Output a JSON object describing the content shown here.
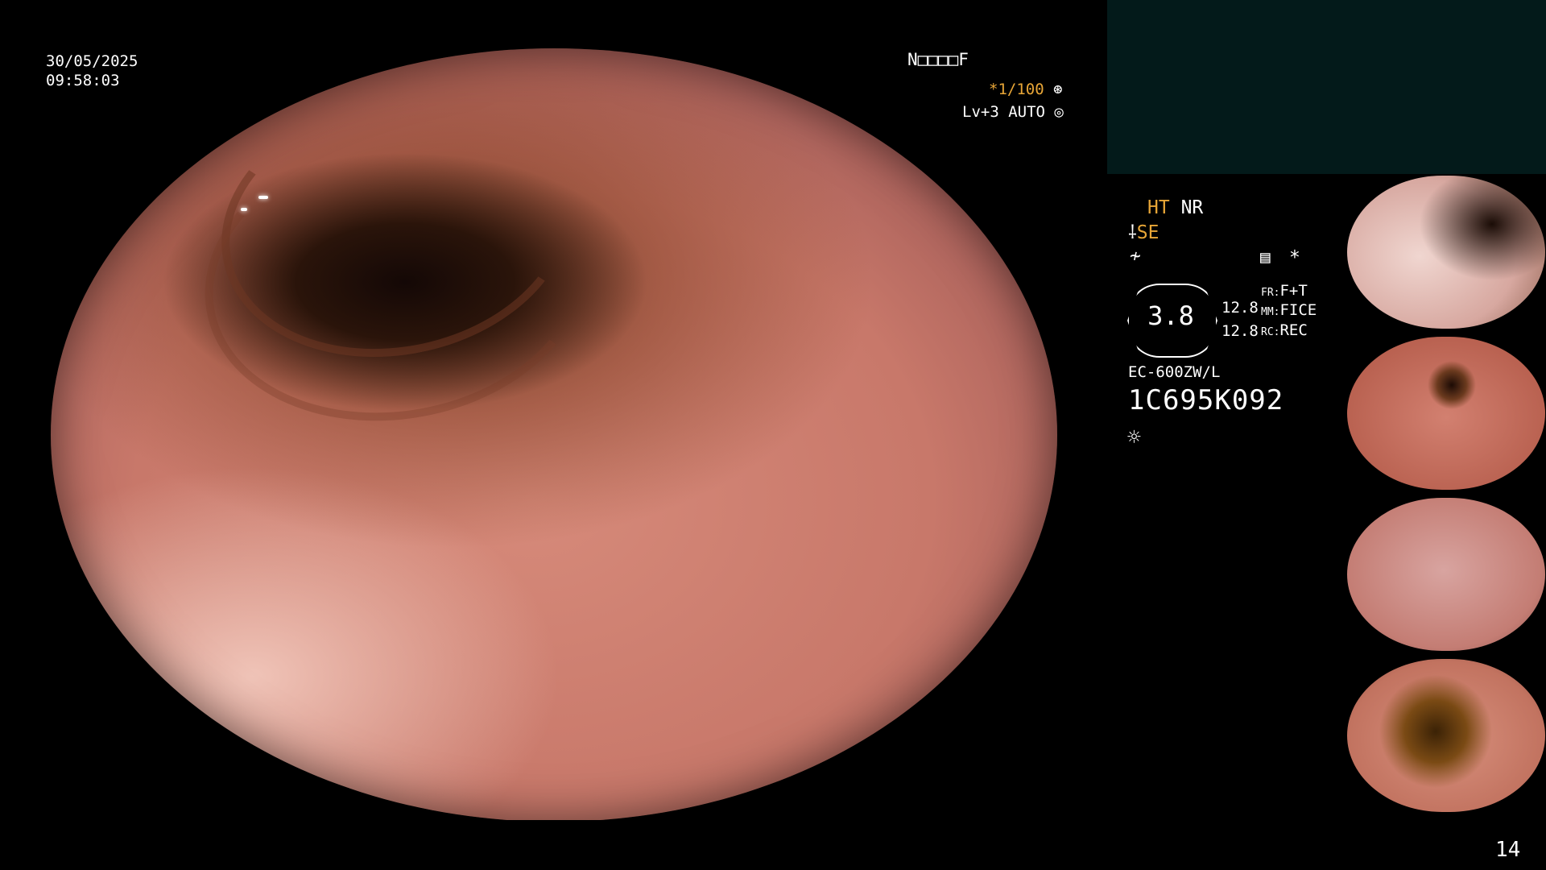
{
  "overlay": {
    "date": "30/05/2025",
    "time": "09:58:03",
    "name_field": "N□□□□F",
    "shutter": "*1/100",
    "light_level": "Lv+3 AUTO"
  },
  "settings": {
    "ht_label": "HT",
    "nr_label": "NR",
    "se_label": "SE",
    "gauge_value": "3.8",
    "value_upper": "12.8",
    "value_lower": "12.8",
    "fr_key": "FR:",
    "fr_value": "F+T",
    "mm_key": "MM:",
    "mm_value": "FICE",
    "rc_key": "RC:",
    "rc_value": "REC",
    "scope_model": "EC-600ZW/L",
    "scope_serial": "1C695K092"
  },
  "page_number": "14",
  "icons": [
    "shutter-icon",
    "auto-icon",
    "scope-icon",
    "function-icon",
    "memory-icon",
    "asterisk-icon",
    "light-icon"
  ],
  "colors": {
    "accent_amber": "#e8a637",
    "panel_teal": "#031a1a"
  }
}
